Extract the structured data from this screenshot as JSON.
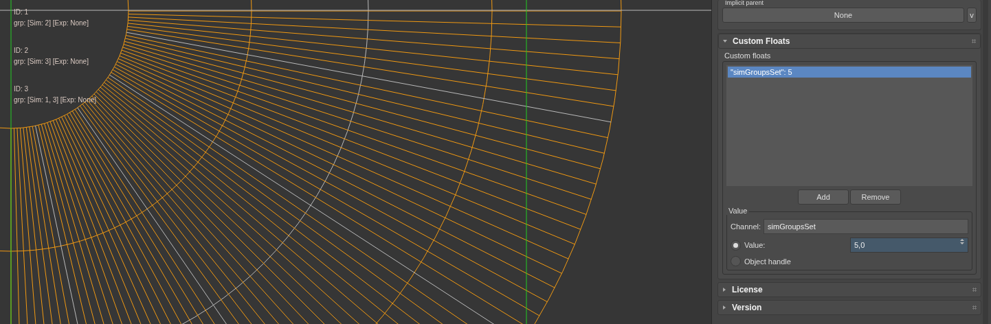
{
  "viewport": {
    "labels": [
      {
        "id": "ID: 1",
        "grp": "grp: [Sim: 2] [Exp: None]"
      },
      {
        "id": "ID: 2",
        "grp": "grp: [Sim: 3] [Exp: None]"
      },
      {
        "id": "ID: 3",
        "grp": "grp: [Sim: 1, 3] [Exp: None]"
      }
    ]
  },
  "implicit_parent": {
    "label": "Implicit parent",
    "value": "None",
    "dropdown": "v"
  },
  "custom_floats": {
    "title": "Custom Floats",
    "expanded": true,
    "list_label": "Custom floats",
    "items": [
      {
        "text": "\"simGroupsSet\": 5",
        "selected": true
      }
    ],
    "buttons": [
      "Add",
      "Remove"
    ],
    "value_group": {
      "title": "Value",
      "channel_label": "Channel:",
      "channel": "simGroupsSet",
      "options": [
        {
          "label": "Value:",
          "selected": true,
          "field": "5,0"
        },
        {
          "label": "Object handle",
          "selected": false
        }
      ]
    }
  },
  "rollouts": [
    {
      "title": "License",
      "expanded": false
    },
    {
      "title": "Version",
      "expanded": false
    }
  ]
}
